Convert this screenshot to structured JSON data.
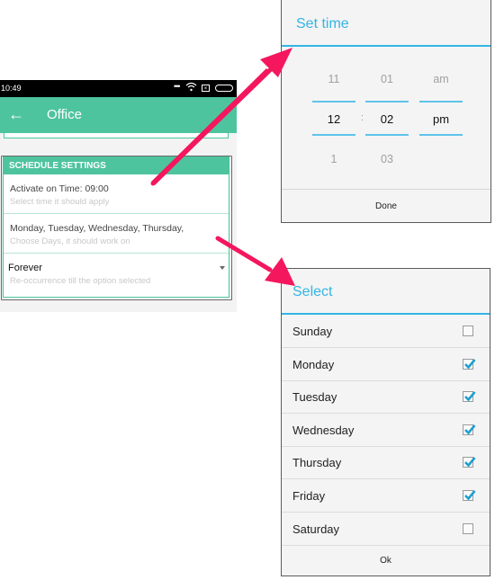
{
  "colors": {
    "app_green": "#4ec49e",
    "dialog_accent": "#33b5e5",
    "arrow": "#f4175e",
    "checkbox_check": "#1d9fd0"
  },
  "phone": {
    "status_bar": {
      "time": "10:49",
      "icons": [
        "more-dots-icon",
        "wifi-icon",
        "sim-icon",
        "battery-icon"
      ]
    },
    "app_bar": {
      "back_icon": "arrow-left-icon",
      "title": "Office"
    },
    "schedule": {
      "header": "SCHEDULE SETTINGS",
      "rows": [
        {
          "main": "Activate on Time: 09:00",
          "sub": "Select time it should apply"
        },
        {
          "main": "Monday, Tuesday, Wednesday, Thursday,",
          "sub": "Choose Days, it should work on"
        },
        {
          "main": "Forever",
          "sub": "Re-occurrence till the option selected",
          "dropdown": true
        }
      ]
    }
  },
  "time_dialog": {
    "title": "Set time",
    "hour": {
      "prev": "11",
      "selected": "12",
      "next": "1"
    },
    "separator": ":",
    "minute": {
      "prev": "01",
      "selected": "02",
      "next": "03"
    },
    "ampm": {
      "prev": "am",
      "selected": "pm",
      "next": ""
    },
    "button": "Done"
  },
  "days_dialog": {
    "title": "Select",
    "days": [
      {
        "label": "Sunday",
        "checked": false
      },
      {
        "label": "Monday",
        "checked": true
      },
      {
        "label": "Tuesday",
        "checked": true
      },
      {
        "label": "Wednesday",
        "checked": true
      },
      {
        "label": "Thursday",
        "checked": true
      },
      {
        "label": "Friday",
        "checked": true
      },
      {
        "label": "Saturday",
        "checked": false
      }
    ],
    "button": "Ok"
  }
}
